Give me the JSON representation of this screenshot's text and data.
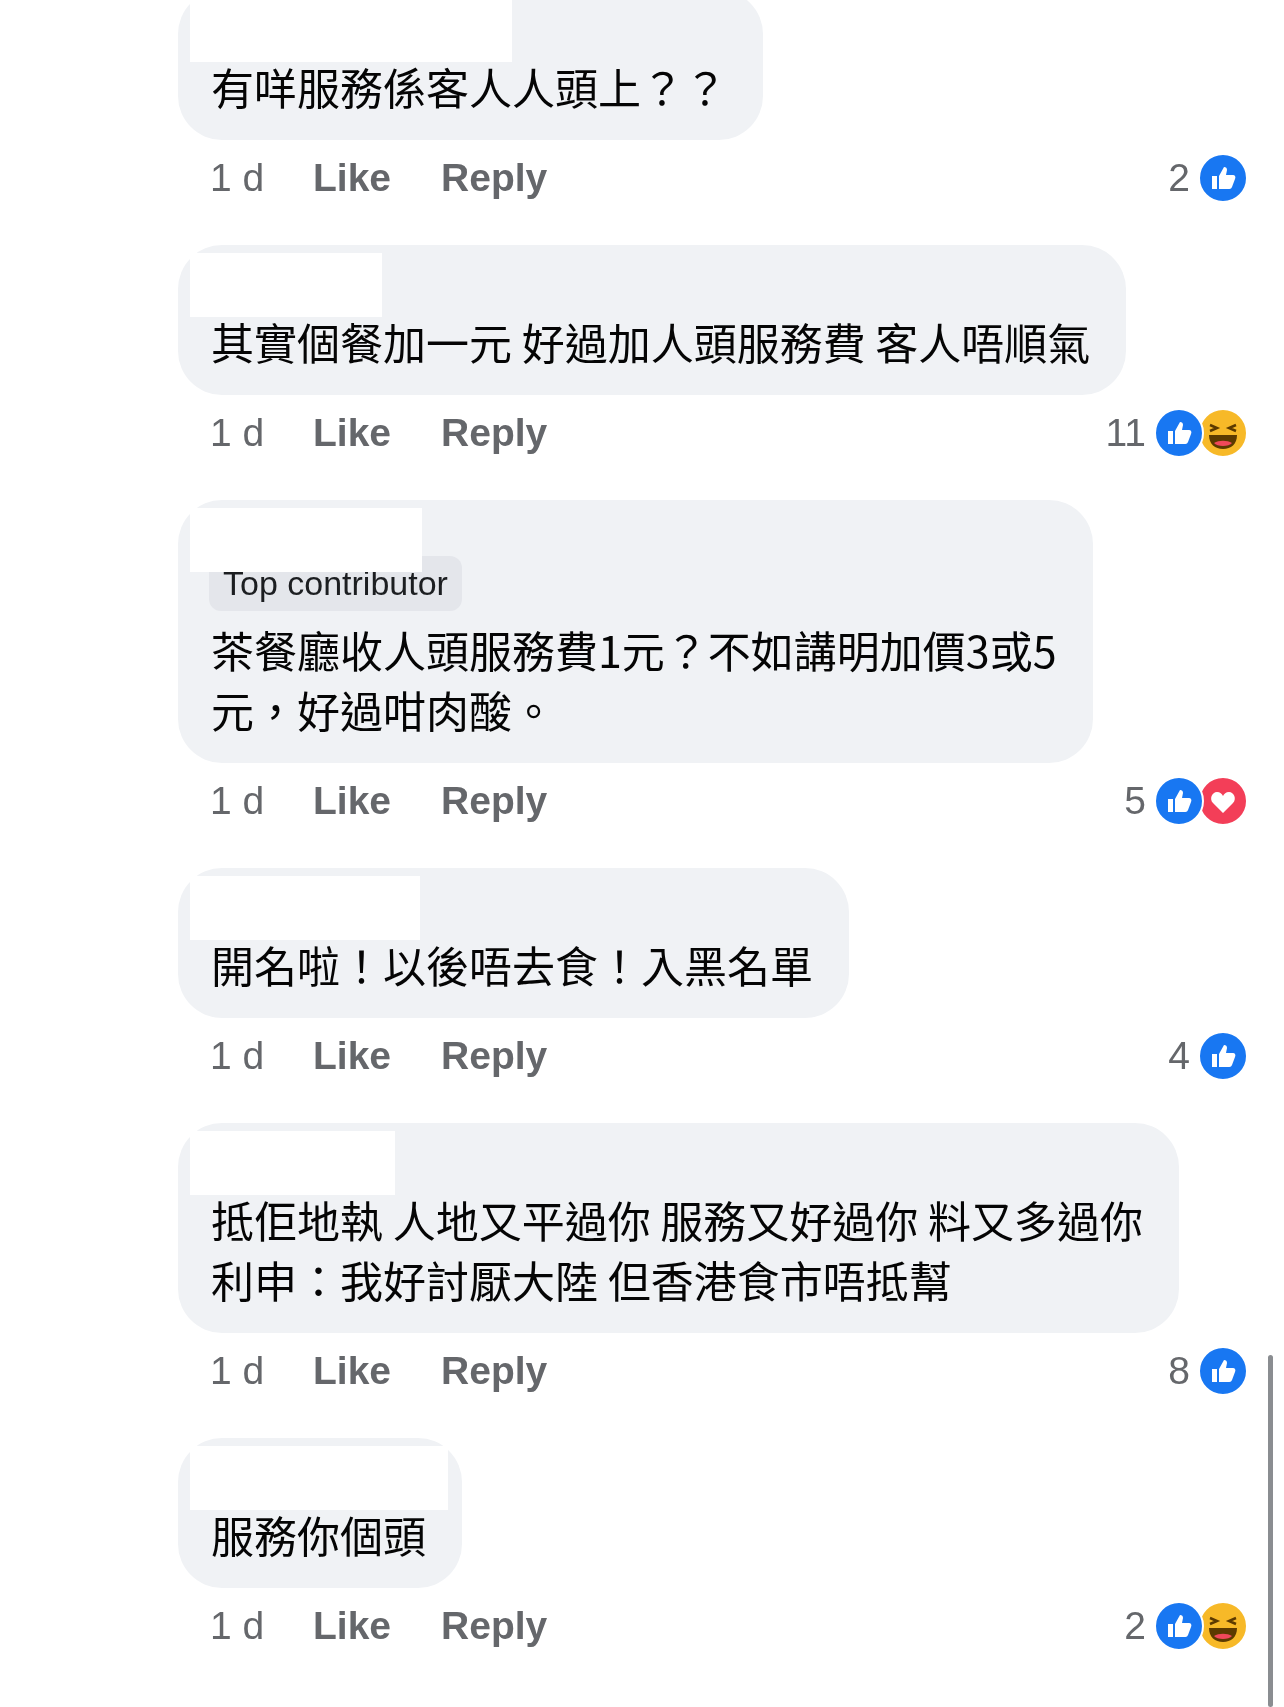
{
  "comments": [
    {
      "lines": [
        "有咩服務係客人人頭上？？"
      ],
      "time": "1 d",
      "like": "Like",
      "reply": "Reply",
      "reaction_count": "2",
      "reactions": [
        {
          "kind": "like"
        }
      ]
    },
    {
      "lines": [
        "其實個餐加一元 好過加人頭服務費 客人唔順氣"
      ],
      "time": "1 d",
      "like": "Like",
      "reply": "Reply",
      "reaction_count": "11",
      "reactions": [
        {
          "kind": "like"
        },
        {
          "kind": "haha"
        }
      ]
    },
    {
      "badge": "Top contributor",
      "lines": [
        "茶餐廳收人頭服務費1元？不如講明加價3或5",
        "元，好過咁肉酸。"
      ],
      "time": "1 d",
      "like": "Like",
      "reply": "Reply",
      "reaction_count": "5",
      "reactions": [
        {
          "kind": "like"
        },
        {
          "kind": "love"
        }
      ]
    },
    {
      "lines": [
        "開名啦！以後唔去食！入黑名單"
      ],
      "time": "1 d",
      "like": "Like",
      "reply": "Reply",
      "reaction_count": "4",
      "reactions": [
        {
          "kind": "like"
        }
      ]
    },
    {
      "lines": [
        "抵佢地執 人地又平過你 服務又好過你 料又多過你",
        "利申：我好討厭大陸 但香港食市唔抵幫"
      ],
      "time": "1 d",
      "like": "Like",
      "reply": "Reply",
      "reaction_count": "8",
      "reactions": [
        {
          "kind": "like"
        }
      ]
    },
    {
      "lines": [
        "服務你個頭"
      ],
      "time": "1 d",
      "like": "Like",
      "reply": "Reply",
      "reaction_count": "2",
      "reactions": [
        {
          "kind": "like"
        },
        {
          "kind": "haha"
        }
      ]
    }
  ]
}
